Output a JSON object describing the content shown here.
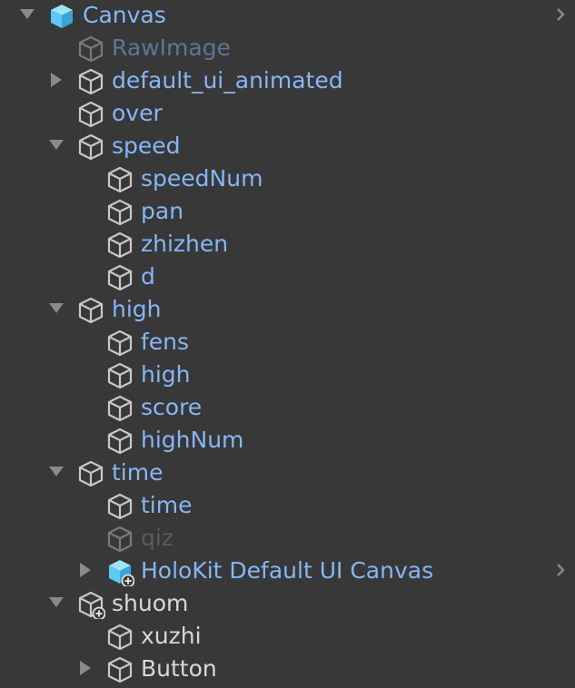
{
  "colors": {
    "panel_bg": "#383838",
    "label_active": "#86b6f6",
    "label_inactive": "#5d7596",
    "label_gray": "#5b5b5b",
    "icon_stroke": "#c8c8c8",
    "prefab_icon": "#5ec8f2"
  },
  "hierarchy": {
    "items": [
      {
        "label": "Canvas",
        "depth": 0,
        "expanded": true,
        "icon": "prefab-cube-icon",
        "state": "active",
        "more": true
      },
      {
        "label": "RawImage",
        "depth": 1,
        "icon": "cube-outline-icon",
        "state": "inactive"
      },
      {
        "label": "default_ui_animated",
        "depth": 1,
        "expanded": false,
        "icon": "cube-outline-icon",
        "state": "active"
      },
      {
        "label": "over",
        "depth": 1,
        "icon": "cube-outline-icon",
        "state": "active"
      },
      {
        "label": "speed",
        "depth": 1,
        "expanded": true,
        "icon": "cube-outline-icon",
        "state": "active"
      },
      {
        "label": "speedNum",
        "depth": 2,
        "icon": "cube-outline-icon",
        "state": "active"
      },
      {
        "label": "pan",
        "depth": 2,
        "icon": "cube-outline-icon",
        "state": "active"
      },
      {
        "label": "zhizhen",
        "depth": 2,
        "icon": "cube-outline-icon",
        "state": "active"
      },
      {
        "label": "d",
        "depth": 2,
        "icon": "cube-outline-icon",
        "state": "active"
      },
      {
        "label": "high",
        "depth": 1,
        "expanded": true,
        "icon": "cube-outline-icon",
        "state": "active"
      },
      {
        "label": "fens",
        "depth": 2,
        "icon": "cube-outline-icon",
        "state": "active"
      },
      {
        "label": "high",
        "depth": 2,
        "icon": "cube-outline-icon",
        "state": "active"
      },
      {
        "label": "score",
        "depth": 2,
        "icon": "cube-outline-icon",
        "state": "active"
      },
      {
        "label": "highNum",
        "depth": 2,
        "icon": "cube-outline-icon",
        "state": "active"
      },
      {
        "label": "time",
        "depth": 1,
        "expanded": true,
        "icon": "cube-outline-icon",
        "state": "active"
      },
      {
        "label": "time",
        "depth": 2,
        "icon": "cube-outline-icon",
        "state": "active"
      },
      {
        "label": "qiz",
        "depth": 2,
        "icon": "cube-outline-icon",
        "state": "gray"
      },
      {
        "label": "HoloKit Default UI Canvas",
        "depth": 2,
        "expanded": false,
        "icon": "prefab-added-icon",
        "state": "active",
        "more": true
      },
      {
        "label": "shuom",
        "depth": 1,
        "expanded": true,
        "icon": "cube-added-icon",
        "state": "white"
      },
      {
        "label": "xuzhi",
        "depth": 2,
        "icon": "cube-outline-icon",
        "state": "white"
      },
      {
        "label": "Button",
        "depth": 2,
        "expanded": false,
        "icon": "cube-outline-icon",
        "state": "white"
      }
    ]
  }
}
